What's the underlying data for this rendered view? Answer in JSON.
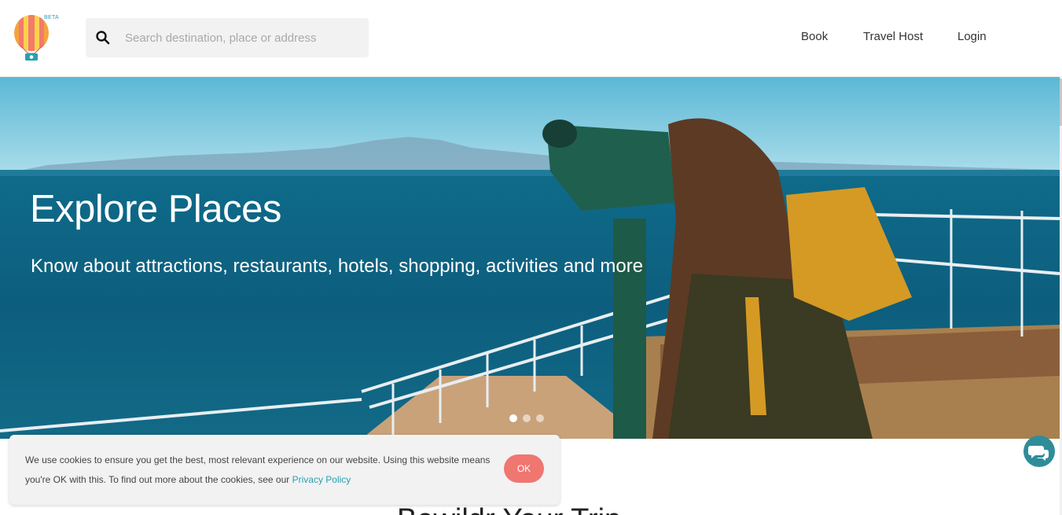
{
  "header": {
    "logo_badge": "BETA",
    "search_placeholder": "Search destination, place or address",
    "nav": [
      "Book",
      "Travel Host",
      "Login"
    ]
  },
  "hero": {
    "title": "Explore Places",
    "subtitle": "Know about attractions, restaurants, hotels, shopping, activities and more",
    "slides": 3,
    "active_slide": 1
  },
  "section": {
    "title": "Bewildr Your Trip"
  },
  "cookie_banner": {
    "text": "We use cookies to ensure you get the best, most relevant experience on our website. Using this website means you're OK with this. To find out more about the cookies, see our",
    "link_label": "Privacy Policy",
    "ok_label": "OK"
  },
  "icons": {
    "search": "search-icon",
    "chat": "chat-icon",
    "logo": "hot-air-balloon-logo"
  },
  "colors": {
    "accent": "#2a9fb0",
    "ok_button": "#f07670",
    "chat_button": "#2f8d99"
  }
}
